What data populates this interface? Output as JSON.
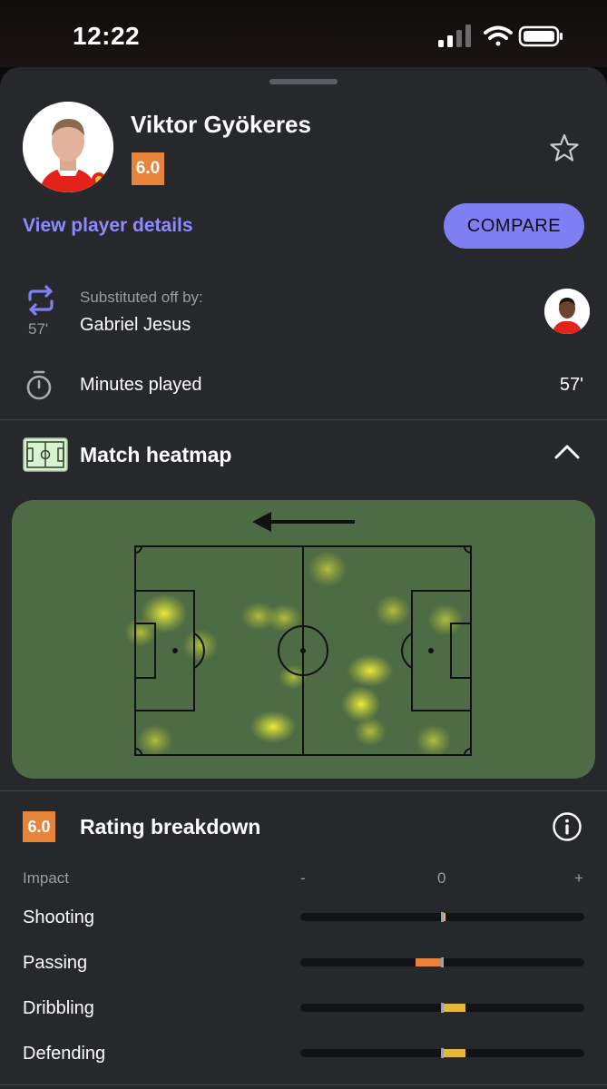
{
  "status_bar": {
    "time": "12:22"
  },
  "player": {
    "name": "Viktor Gyökeres",
    "rating": "6.0",
    "details_link": "View player details",
    "compare_label": "COMPARE"
  },
  "substitution": {
    "caption": "Substituted off by:",
    "minute": "57'",
    "player_name": "Gabriel Jesus"
  },
  "minutes": {
    "label": "Minutes played",
    "value": "57'"
  },
  "heatmap": {
    "title": "Match heatmap",
    "attack_direction": "left"
  },
  "rating_breakdown": {
    "title": "Rating breakdown",
    "rating": "6.0",
    "impact_label": "Impact",
    "scale": {
      "min": "-",
      "mid": "0",
      "max": "+"
    },
    "metrics": [
      {
        "label": "Shooting",
        "impact": 0.02,
        "color": "#e2b93b"
      },
      {
        "label": "Passing",
        "impact": -0.19,
        "color": "#e8843a"
      },
      {
        "label": "Dribbling",
        "impact": 0.16,
        "color": "#e2b93b"
      },
      {
        "label": "Defending",
        "impact": 0.16,
        "color": "#e2b93b"
      }
    ]
  },
  "colors": {
    "background": "#26282c",
    "accent": "#7f7ff3",
    "link": "#8c8bff",
    "rating_orange": "#e8843a",
    "pitch": "#4d6b44",
    "positive_bar": "#e2b93b"
  }
}
